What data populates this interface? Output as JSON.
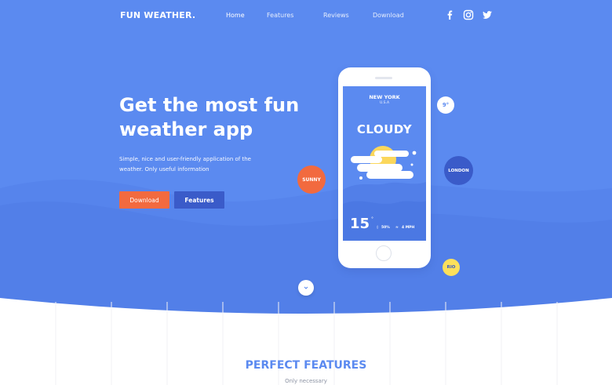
{
  "brand": {
    "logo": "FUN WEATHER."
  },
  "nav": {
    "links": [
      "Home",
      "Features",
      "Reviews",
      "Download"
    ],
    "active": "Home"
  },
  "social": [
    "facebook-icon",
    "instagram-icon",
    "twitter-icon"
  ],
  "hero": {
    "headline_line1": "Get the most fun",
    "headline_line2": "weather app",
    "subtitle_line1": "Simple, nice and user-friendly application of the",
    "subtitle_line2": "weather. Only useful information",
    "download_label": "Download",
    "features_label": "Features"
  },
  "phone": {
    "city": "NEW YORK",
    "country": "U.S.A",
    "condition": "CLOUDY",
    "temperature": "15",
    "degree": "°",
    "humidity": "50%",
    "wind": "4 MPH"
  },
  "bubbles": {
    "nine": "9°",
    "london": "LONDON",
    "sunny": "SUNNY",
    "rio": "RIO"
  },
  "features_section": {
    "title": "PERFECT FEATURES",
    "subtitle": "Only necessary"
  },
  "colors": {
    "primary": "#5b8af0",
    "dark_blue": "#3a5bc9",
    "orange": "#f26a3f",
    "yellow": "#fde05b",
    "sun": "#fbd75b"
  }
}
